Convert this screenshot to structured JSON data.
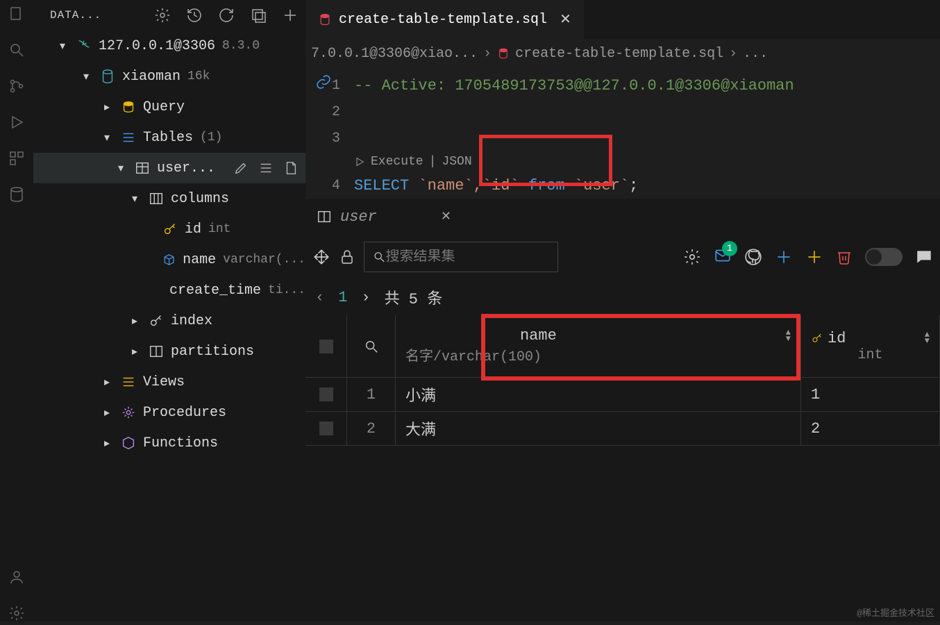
{
  "sidebar": {
    "title": "DATA...",
    "connection": {
      "host": "127.0.0.1@3306",
      "version": "8.3.0"
    },
    "database": {
      "name": "xiaoman",
      "size": "16k"
    },
    "nodes": {
      "query": "Query",
      "tables": {
        "label": "Tables",
        "count": "(1)"
      },
      "table_user": "user...",
      "columns": "columns",
      "col_id": {
        "name": "id",
        "type": "int"
      },
      "col_name": {
        "name": "name",
        "type": "varchar(..."
      },
      "col_create_time": {
        "name": "create_time",
        "type": "ti..."
      },
      "index": "index",
      "partitions": "partitions",
      "views": "Views",
      "procedures": "Procedures",
      "functions": "Functions"
    }
  },
  "tab": {
    "title": "create-table-template.sql"
  },
  "breadcrumb": {
    "part1": "7.0.0.1@3306@xiao...",
    "part2": "create-table-template.sql",
    "part3": "..."
  },
  "code": {
    "line1": "-- Active: 1705489173753@@127.0.0.1@3306@xiaoman",
    "codelens": {
      "execute": "Execute",
      "json": "JSON"
    },
    "line4": {
      "select": "SELECT",
      "cols": " `name`,`id` ",
      "from": "from",
      "tbl": " `user`",
      "semi": ";"
    },
    "line_numbers": [
      "1",
      "2",
      "3",
      "4"
    ]
  },
  "results": {
    "tab_label": "user",
    "search_placeholder": "搜索结果集",
    "badge": "1",
    "pager": {
      "page": "1",
      "total": "共 5 条"
    },
    "headers": {
      "name": {
        "title": "name",
        "sub": "名字/varchar(100)"
      },
      "id": {
        "title": "id",
        "sub": "int"
      }
    },
    "rows": [
      {
        "n": "1",
        "name": "小满",
        "id": "1"
      },
      {
        "n": "2",
        "name": "大满",
        "id": "2"
      }
    ]
  },
  "watermark": "@稀土掘金技术社区"
}
